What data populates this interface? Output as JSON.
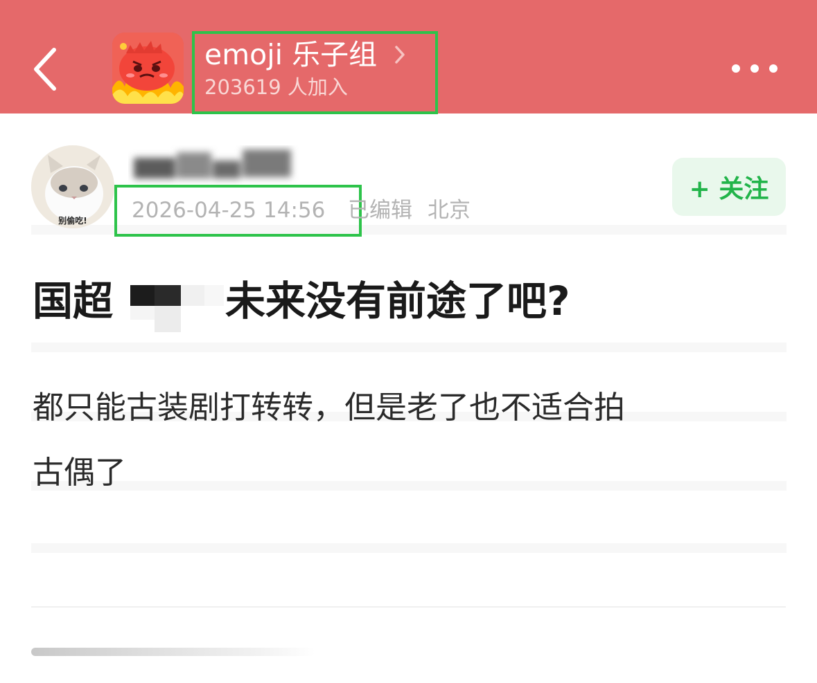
{
  "header": {
    "group_name": "emoji 乐子组",
    "members": "203619 人加入"
  },
  "author": {
    "post_time": "2026-04-25 14:56",
    "edited": "已编辑",
    "location": "北京",
    "avatar_caption": "别偷吃!"
  },
  "follow": {
    "label": "+ 关注"
  },
  "post": {
    "title_start": "国超",
    "title_end": "未来没有前途了吧?",
    "body_line1": "都只能古装剧打转转，但是老了也不适合拍",
    "body_line2": "古偶了"
  },
  "colors": {
    "header_bg": "#e5696a",
    "highlight_box": "#2dc34a",
    "follow_text": "#22b44a",
    "follow_bg": "#e9f8ec"
  },
  "icons": {
    "back": "chevron-left-icon",
    "group_enter": "chevron-right-icon",
    "more": "more-dots-icon"
  }
}
